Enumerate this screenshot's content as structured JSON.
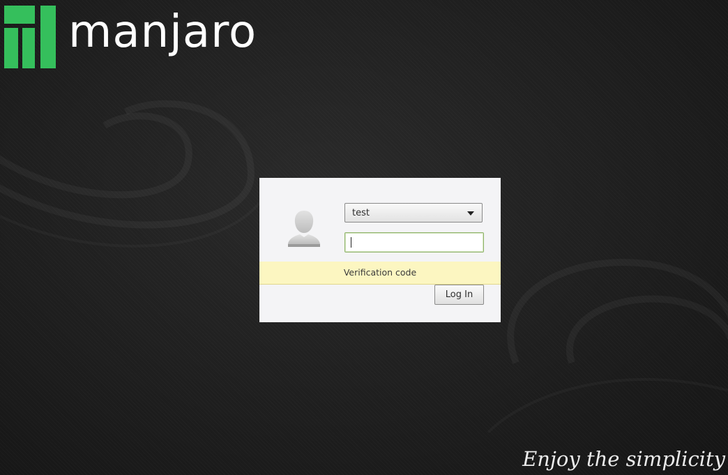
{
  "branding": {
    "logo_text": "manjaro",
    "logo_icon": "manjaro-logo-icon",
    "logo_color": "#35bf5c",
    "tagline": "Enjoy the simplicity"
  },
  "login": {
    "avatar_icon": "user-avatar-icon",
    "user_select": {
      "selected": "test",
      "icon": "caret-down-icon"
    },
    "code_input": {
      "value": "",
      "placeholder": ""
    },
    "prompt": "Verification code",
    "login_button_label": "Log In",
    "accent_color": "#8fb36a",
    "prompt_bg_color": "#fcf6c1"
  }
}
